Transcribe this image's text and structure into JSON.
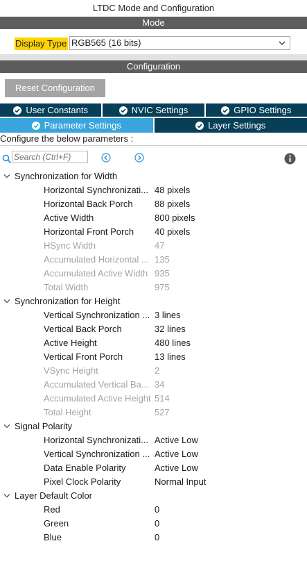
{
  "window": {
    "title": "LTDC Mode and Configuration"
  },
  "mode_section": {
    "title": "Mode"
  },
  "display_type": {
    "label": "Display Type",
    "value": "RGB565 (16 bits)"
  },
  "config_section": {
    "title": "Configuration"
  },
  "reset_button": {
    "label": "Reset Configuration"
  },
  "tabs_row1": [
    {
      "label": "User Constants",
      "icon": "check-circle-icon"
    },
    {
      "label": "NVIC Settings",
      "icon": "check-circle-icon"
    },
    {
      "label": "GPIO Settings",
      "icon": "check-circle-icon"
    }
  ],
  "tabs_row2": [
    {
      "label": "Parameter Settings",
      "icon": "check-circle-icon",
      "active": true
    },
    {
      "label": "Layer Settings",
      "icon": "check-circle-icon",
      "active": false
    }
  ],
  "hint": "Configure the below parameters :",
  "search": {
    "placeholder": "Search (Ctrl+F)"
  },
  "colors": {
    "tab_dark": "#063f57",
    "tab_active": "#39a5dc",
    "highlight": "#ffd400",
    "section_bar": "#5d5d5d"
  },
  "groups": [
    {
      "name": "Synchronization for Width",
      "params": [
        {
          "name": "Horizontal Synchronizati...",
          "value": "48 pixels",
          "disabled": false
        },
        {
          "name": "Horizontal Back Porch",
          "value": "88 pixels",
          "disabled": false
        },
        {
          "name": "Active Width",
          "value": "800 pixels",
          "disabled": false
        },
        {
          "name": "Horizontal Front Porch",
          "value": "40 pixels",
          "disabled": false
        },
        {
          "name": "HSync Width",
          "value": "47",
          "disabled": true
        },
        {
          "name": "Accumulated Horizontal ...",
          "value": "135",
          "disabled": true
        },
        {
          "name": "Accumulated Active Width",
          "value": "935",
          "disabled": true
        },
        {
          "name": "Total Width",
          "value": "975",
          "disabled": true
        }
      ]
    },
    {
      "name": "Synchronization for Height",
      "params": [
        {
          "name": "Vertical Synchronization ...",
          "value": "3 lines",
          "disabled": false
        },
        {
          "name": "Vertical Back Porch",
          "value": "32 lines",
          "disabled": false
        },
        {
          "name": "Active Height",
          "value": "480 lines",
          "disabled": false
        },
        {
          "name": "Vertical Front Porch",
          "value": "13 lines",
          "disabled": false
        },
        {
          "name": "VSync Height",
          "value": "2",
          "disabled": true
        },
        {
          "name": "Accumulated Vertical Ba...",
          "value": "34",
          "disabled": true
        },
        {
          "name": "Accumulated Active Height",
          "value": "514",
          "disabled": true
        },
        {
          "name": "Total Height",
          "value": "527",
          "disabled": true
        }
      ]
    },
    {
      "name": "Signal Polarity",
      "params": [
        {
          "name": "Horizontal Synchronizati...",
          "value": "Active Low",
          "disabled": false
        },
        {
          "name": "Vertical Synchronization ...",
          "value": "Active Low",
          "disabled": false
        },
        {
          "name": "Data Enable Polarity",
          "value": "Active Low",
          "disabled": false
        },
        {
          "name": "Pixel Clock Polarity",
          "value": "Normal Input",
          "disabled": false
        }
      ]
    },
    {
      "name": "Layer Default Color",
      "params": [
        {
          "name": "Red",
          "value": "0",
          "disabled": false
        },
        {
          "name": "Green",
          "value": "0",
          "disabled": false
        },
        {
          "name": "Blue",
          "value": "0",
          "disabled": false
        }
      ]
    }
  ]
}
